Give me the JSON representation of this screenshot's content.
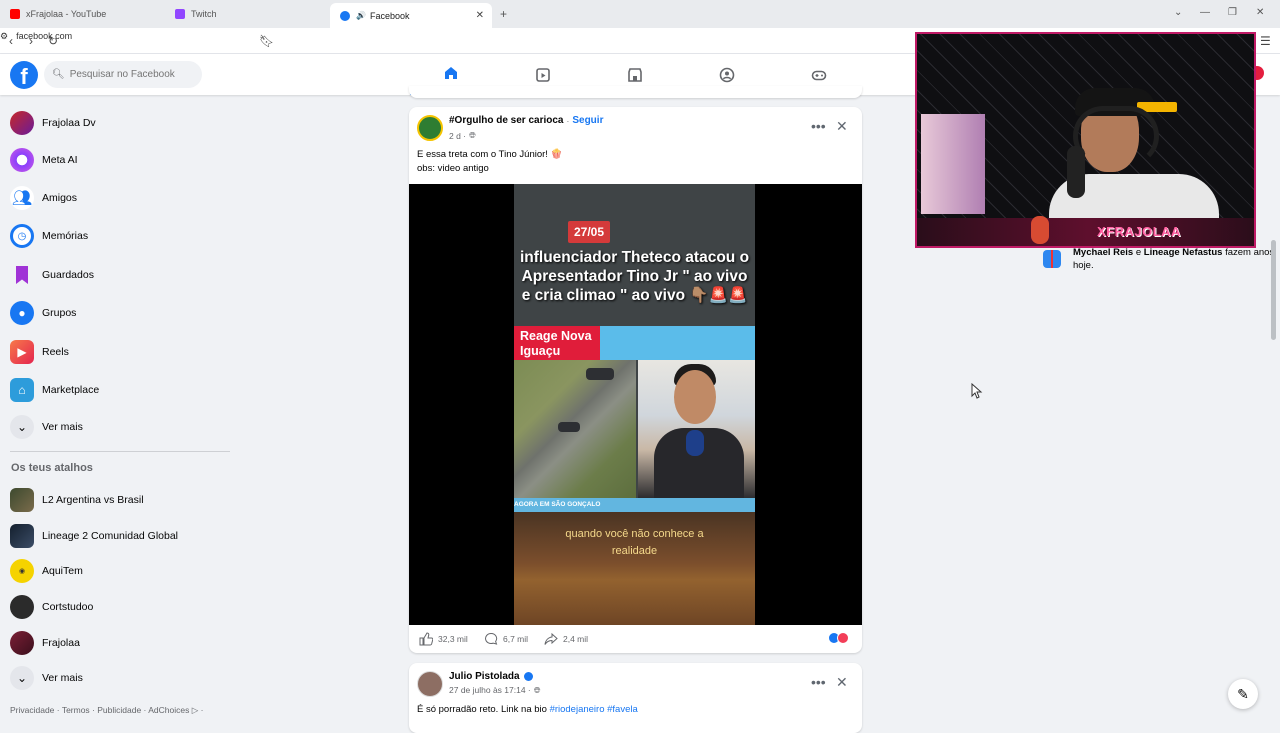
{
  "browser": {
    "tabs": [
      {
        "label": "xFrajolaa - YouTube",
        "color": "#ff0000"
      },
      {
        "label": "Twitch",
        "color": "#9146ff"
      },
      {
        "label": "Facebook",
        "color": "#1877f2",
        "active": true
      }
    ],
    "url": "facebook.com"
  },
  "header": {
    "logo": "f",
    "search_placeholder": "Pesquisar no Facebook",
    "nav_icons": [
      "home-icon",
      "video-icon",
      "marketplace-icon",
      "groups-icon",
      "gaming-icon"
    ]
  },
  "sidebar": {
    "items": [
      {
        "label": "Frajolaa Dv",
        "icon": "profile-avatar"
      },
      {
        "label": "Meta AI",
        "icon": "meta-ai-icon"
      },
      {
        "label": "Amigos",
        "icon": "friends-icon"
      },
      {
        "label": "Memórias",
        "icon": "memories-icon"
      },
      {
        "label": "Guardados",
        "icon": "saved-icon"
      },
      {
        "label": "Grupos",
        "icon": "groups-icon"
      },
      {
        "label": "Reels",
        "icon": "reels-icon"
      },
      {
        "label": "Marketplace",
        "icon": "marketplace-icon"
      },
      {
        "label": "Ver mais",
        "icon": "chevron-down-icon"
      }
    ],
    "shortcuts_title": "Os teus atalhos",
    "shortcuts": [
      {
        "label": "L2 Argentina vs Brasil"
      },
      {
        "label": "Lineage 2 Comunidad Global"
      },
      {
        "label": "AquiTem"
      },
      {
        "label": "Cortstudoo"
      },
      {
        "label": "Frajolaa"
      },
      {
        "label": "Ver mais"
      }
    ],
    "footer": "Privacidade · Termos · Publicidade · AdChoices ▷ ·"
  },
  "post1": {
    "page": "#Orgulho de ser carioca",
    "follow": "Seguir",
    "time": "2 d ·",
    "text_line1": "E essa treta com o Tino Júnior! 🍿",
    "text_line2": "obs: video antigo",
    "video": {
      "date_badge": "27/05",
      "headline": "influenciador Theteco atacou o Apresentador Tino Jr \" ao vivo e cria climao \" ao vivo 👇🏽🚨🚨",
      "tag_line1": "Reage Nova",
      "tag_line2": "Iguaçu",
      "lower_third": "AGORA EM SÃO GONÇALO",
      "subtitle": "quando você não conhece a realidade"
    },
    "likes": "32,3 mil",
    "comments": "6,7 mil",
    "shares": "2,4 mil"
  },
  "post2": {
    "author": "Julio Pistolada",
    "time": "27 de julho às 17:14 ·",
    "text": "É só porradão reto. Link na bio ",
    "tags": "#riodejaneiro #favela"
  },
  "birthday": {
    "names": "Mychael Reis",
    "conj": " e ",
    "names2": "Lineage Nefastus",
    "suffix": " fazem anos hoje."
  },
  "webcam": {
    "name": "XFRAJOLAA"
  }
}
